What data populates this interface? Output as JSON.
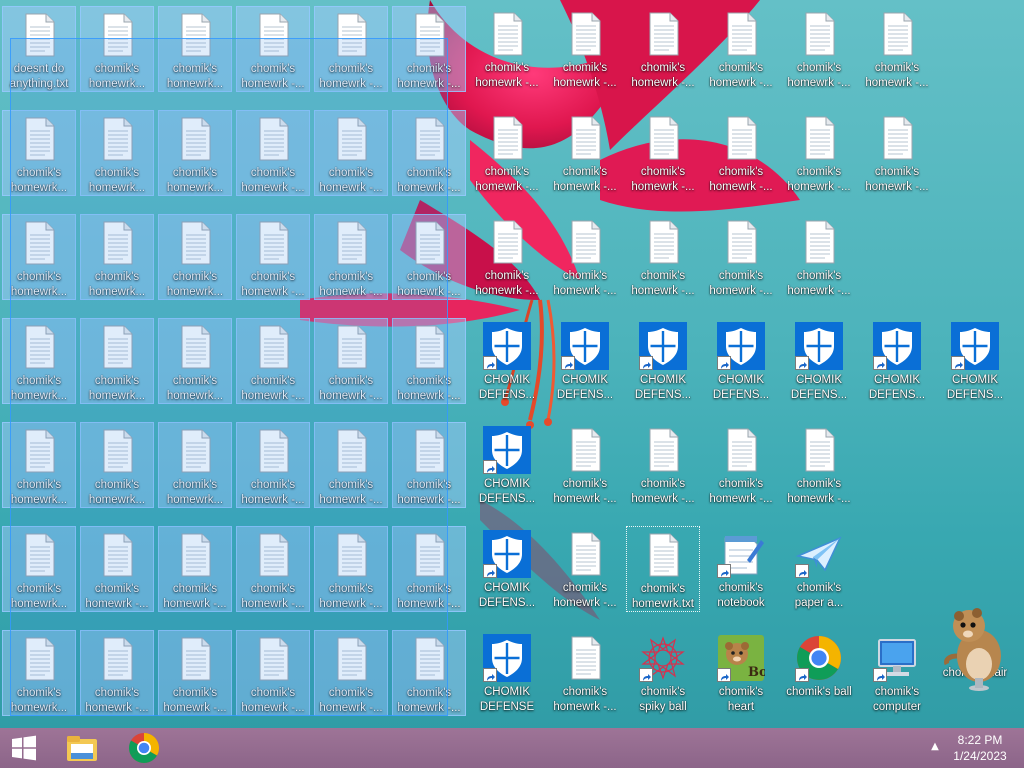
{
  "desktop": {
    "icons": [
      {
        "label": "doesnt do anything.txt",
        "type": "txt",
        "selected": true
      },
      {
        "label": "chomik's homewrk...",
        "type": "txt",
        "selected": true
      },
      {
        "label": "chomik's homewrk...",
        "type": "txt",
        "selected": true
      },
      {
        "label": "chomik's homewrk -...",
        "type": "txt",
        "selected": true
      },
      {
        "label": "chomik's homewrk -...",
        "type": "txt",
        "selected": true
      },
      {
        "label": "chomik's homewrk -...",
        "type": "txt",
        "selected": true
      },
      {
        "label": "chomik's homewrk -...",
        "type": "txt",
        "selected": false
      },
      {
        "label": "chomik's homewrk -...",
        "type": "txt",
        "selected": false
      },
      {
        "label": "chomik's homewrk -...",
        "type": "txt",
        "selected": false
      },
      {
        "label": "chomik's homewrk -...",
        "type": "txt",
        "selected": false
      },
      {
        "label": "chomik's homewrk -...",
        "type": "txt",
        "selected": false
      },
      {
        "label": "chomik's homewrk -...",
        "type": "txt",
        "selected": false
      },
      {
        "label": "chomik's homewrk...",
        "type": "txt",
        "selected": true
      },
      {
        "label": "chomik's homewrk...",
        "type": "txt",
        "selected": true
      },
      {
        "label": "chomik's homewrk...",
        "type": "txt",
        "selected": true
      },
      {
        "label": "chomik's homewrk -...",
        "type": "txt",
        "selected": true
      },
      {
        "label": "chomik's homewrk -...",
        "type": "txt",
        "selected": true
      },
      {
        "label": "chomik's homewrk -...",
        "type": "txt",
        "selected": true
      },
      {
        "label": "chomik's homewrk -...",
        "type": "txt",
        "selected": false
      },
      {
        "label": "chomik's homewrk -...",
        "type": "txt",
        "selected": false
      },
      {
        "label": "chomik's homewrk -...",
        "type": "txt",
        "selected": false
      },
      {
        "label": "chomik's homewrk -...",
        "type": "txt",
        "selected": false
      },
      {
        "label": "chomik's homewrk -...",
        "type": "txt",
        "selected": false
      },
      {
        "label": "chomik's homewrk -...",
        "type": "txt",
        "selected": false
      },
      {
        "label": "chomik's homewrk...",
        "type": "txt",
        "selected": true
      },
      {
        "label": "chomik's homewrk...",
        "type": "txt",
        "selected": true
      },
      {
        "label": "chomik's homewrk...",
        "type": "txt",
        "selected": true
      },
      {
        "label": "chomik's homewrk -...",
        "type": "txt",
        "selected": true
      },
      {
        "label": "chomik's homewrk -...",
        "type": "txt",
        "selected": true
      },
      {
        "label": "chomik's homewrk -...",
        "type": "txt",
        "selected": true
      },
      {
        "label": "chomik's homewrk -...",
        "type": "txt",
        "selected": false
      },
      {
        "label": "chomik's homewrk -...",
        "type": "txt",
        "selected": false
      },
      {
        "label": "chomik's homewrk -...",
        "type": "txt",
        "selected": false
      },
      {
        "label": "chomik's homewrk -...",
        "type": "txt",
        "selected": false
      },
      {
        "label": "chomik's homewrk -...",
        "type": "txt",
        "selected": false
      },
      {
        "label": "chomik's homewrk...",
        "type": "txt",
        "selected": true
      },
      {
        "label": "chomik's homewrk...",
        "type": "txt",
        "selected": true
      },
      {
        "label": "chomik's homewrk...",
        "type": "txt",
        "selected": true
      },
      {
        "label": "chomik's homewrk -...",
        "type": "txt",
        "selected": true
      },
      {
        "label": "chomik's homewrk -...",
        "type": "txt",
        "selected": true
      },
      {
        "label": "chomik's homewrk -...",
        "type": "txt",
        "selected": true
      },
      {
        "label": "CHOMIK DEFENS...",
        "type": "defender",
        "selected": false
      },
      {
        "label": "CHOMIK DEFENS...",
        "type": "defender",
        "selected": false
      },
      {
        "label": "CHOMIK DEFENS...",
        "type": "defender",
        "selected": false
      },
      {
        "label": "CHOMIK DEFENS...",
        "type": "defender",
        "selected": false
      },
      {
        "label": "CHOMIK DEFENS...",
        "type": "defender",
        "selected": false
      },
      {
        "label": "CHOMIK DEFENS...",
        "type": "defender",
        "selected": false
      },
      {
        "label": "CHOMIK DEFENS...",
        "type": "defender",
        "selected": false
      },
      {
        "label": "chomik's homewrk...",
        "type": "txt",
        "selected": true
      },
      {
        "label": "chomik's homewrk...",
        "type": "txt",
        "selected": true
      },
      {
        "label": "chomik's homewrk...",
        "type": "txt",
        "selected": true
      },
      {
        "label": "chomik's homewrk -...",
        "type": "txt",
        "selected": true
      },
      {
        "label": "chomik's homewrk -...",
        "type": "txt",
        "selected": true
      },
      {
        "label": "chomik's homewrk -...",
        "type": "txt",
        "selected": true
      },
      {
        "label": "CHOMIK DEFENS...",
        "type": "defender",
        "selected": false
      },
      {
        "label": "chomik's homewrk -...",
        "type": "txt",
        "selected": false
      },
      {
        "label": "chomik's homewrk -...",
        "type": "txt",
        "selected": false
      },
      {
        "label": "chomik's homewrk -...",
        "type": "txt",
        "selected": false
      },
      {
        "label": "chomik's homewrk -...",
        "type": "txt",
        "selected": false
      },
      {
        "label": "chomik's homewrk...",
        "type": "txt",
        "selected": true
      },
      {
        "label": "chomik's homewrk -...",
        "type": "txt",
        "selected": true
      },
      {
        "label": "chomik's homewrk -...",
        "type": "txt",
        "selected": true
      },
      {
        "label": "chomik's homewrk -...",
        "type": "txt",
        "selected": true
      },
      {
        "label": "chomik's homewrk -...",
        "type": "txt",
        "selected": true
      },
      {
        "label": "chomik's homewrk -...",
        "type": "txt",
        "selected": true
      },
      {
        "label": "CHOMIK DEFENS...",
        "type": "defender",
        "selected": false
      },
      {
        "label": "chomik's homewrk -...",
        "type": "txt",
        "selected": false
      },
      {
        "label": "chomik's homewrk.txt",
        "type": "txt",
        "selected": false,
        "focused": true
      },
      {
        "label": "chomik's notebook",
        "type": "notepad",
        "selected": false
      },
      {
        "label": "chomik's paper a...",
        "type": "paperplane",
        "selected": false
      },
      {
        "label": "chomik's homewrk...",
        "type": "txt",
        "selected": true
      },
      {
        "label": "chomik's homewrk -...",
        "type": "txt",
        "selected": true
      },
      {
        "label": "chomik's homewrk -...",
        "type": "txt",
        "selected": true
      },
      {
        "label": "chomik's homewrk -...",
        "type": "txt",
        "selected": true
      },
      {
        "label": "chomik's homewrk -...",
        "type": "txt",
        "selected": true
      },
      {
        "label": "chomik's homewrk -...",
        "type": "txt",
        "selected": true
      },
      {
        "label": "CHOMIK DEFENSE",
        "type": "defender",
        "selected": false
      },
      {
        "label": "chomik's homewrk -...",
        "type": "txt",
        "selected": false
      },
      {
        "label": "chomik's spiky ball",
        "type": "spiky",
        "selected": false
      },
      {
        "label": "chomik's heart",
        "type": "heart",
        "selected": false
      },
      {
        "label": "chomik's ball",
        "type": "chrome",
        "selected": false
      },
      {
        "label": "chomik's computer",
        "type": "computer",
        "selected": false
      },
      {
        "label": "chomik chair",
        "type": "hamster",
        "selected": false
      }
    ]
  },
  "taskbar": {
    "start_icon": "windows-logo-icon",
    "pinned": [
      {
        "name": "file-explorer-icon"
      },
      {
        "name": "chrome-icon"
      }
    ],
    "tray_chevron": "▲",
    "time": "8:22 PM",
    "date": "1/24/2023"
  },
  "colors": {
    "taskbar": "#8c6589",
    "selection": "#3399ff",
    "defender_blue": "#0a6fd6"
  }
}
